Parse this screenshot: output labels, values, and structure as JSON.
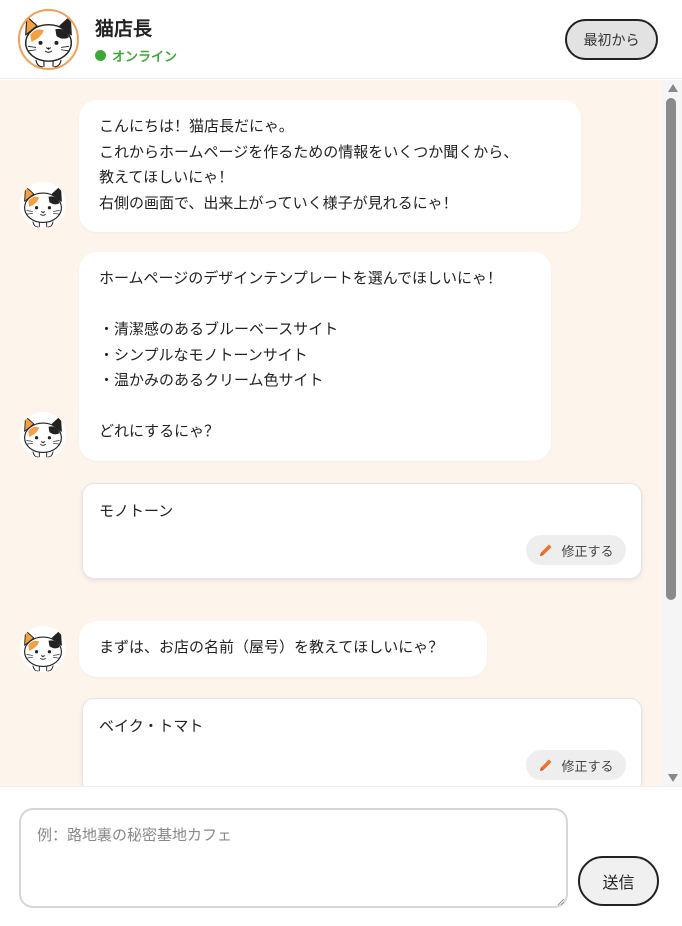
{
  "header": {
    "title": "猫店長",
    "status": "オンライン",
    "restart_label": "最初から"
  },
  "colors": {
    "online": "#3aaa35",
    "chat_background": "#fdf5ec",
    "avatar_ring": "#f0a05a",
    "pencil": "#f07030"
  },
  "messages": [
    {
      "role": "bot",
      "text": "こんにちは！猫店長だにゃ。\nこれからホームページを作るための情報をいくつか聞くから、\n教えてほしいにゃ！\n右側の画面で、出来上がっていく様子が見れるにゃ！"
    },
    {
      "role": "bot",
      "text": "ホームページのデザインテンプレートを選んでほしいにゃ！\n\n・清潔感のあるブルーベースサイト\n・シンプルなモノトーンサイト\n・温かみのあるクリーム色サイト\n\nどれにするにゃ？"
    },
    {
      "role": "user",
      "text": "モノトーン",
      "edit_label": "修正する"
    },
    {
      "role": "bot",
      "text": "まずは、お店の名前（屋号）を教えてほしいにゃ？"
    },
    {
      "role": "user",
      "text": "ベイク・トマト",
      "edit_label": "修正する"
    }
  ],
  "composer": {
    "placeholder": "例：路地裏の秘密基地カフェ",
    "value": "",
    "send_label": "送信"
  },
  "icons": [
    "cat-avatar-icon",
    "pencil-icon",
    "scroll-up-arrow-icon",
    "scroll-down-arrow-icon"
  ]
}
